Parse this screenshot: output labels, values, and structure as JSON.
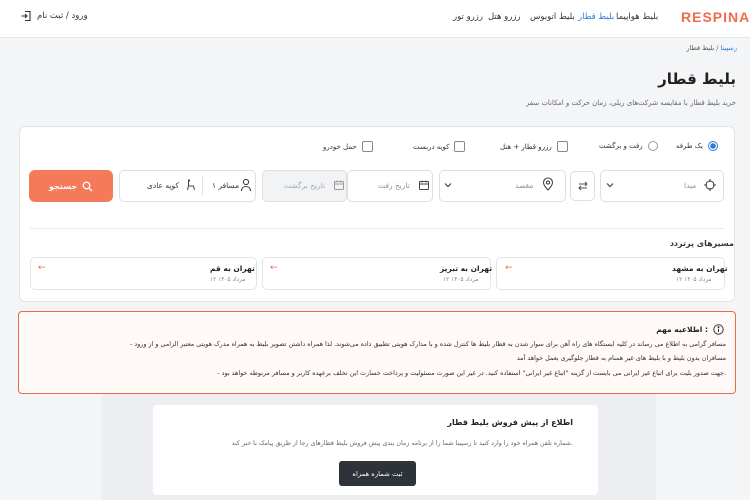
{
  "header": {
    "logo": "RESPINA",
    "nav": {
      "flight": "بلیط هواپیما",
      "train": "بلیط قطار",
      "bus": "بلیط اتوبوس",
      "hotel": "رزرو هتل",
      "tour": "رزرو تور"
    },
    "login_label": "ورود / ثبت نام"
  },
  "breadcrumb": {
    "home": "رسپینا",
    "separator": " / ",
    "current": "بلیط قطار"
  },
  "page": {
    "title": "بلیط قطار",
    "subtitle": "خرید بلیط قطار با مقایسه شرکت‌های ریلی، زمان حرکت و امکانات سفر"
  },
  "search": {
    "trip_types": {
      "one_way": "یک طرفه",
      "round_trip": "رفت و برگشت"
    },
    "extras": {
      "train_hotel": "رزرو قطار + هتل",
      "coupe": "کوپه دربست",
      "car": "حمل خودرو"
    },
    "selected_trip_type": "یک طرفه",
    "origin_placeholder": "مبدا",
    "destination_placeholder": "مقصد",
    "depart_placeholder": "تاریخ رفت",
    "return_placeholder": "تاریخ برگشت",
    "passengers": "۱ مسافر",
    "wagon_type": "کوپه عادی",
    "search_button": "جستجو"
  },
  "popular": {
    "title": "مسیرهای پرتردد",
    "routes": [
      {
        "name": "تهران به مشهد",
        "date": "۱۲ مرداد ۱۴۰۵"
      },
      {
        "name": "تهران به تبریز",
        "date": "۱۲ مرداد ۱۴۰۵"
      },
      {
        "name": "تهران به قم",
        "date": "۱۲ مرداد ۱۴۰۵"
      }
    ]
  },
  "notice": {
    "title": "اطلاعیه مهم :",
    "lines": [
      "- مسافر گرامی به اطلاع می رساند در کلیه ایستگاه های راه آهن برای سوار شدن به قطار بلیط ها کنترل شده و با مدارک هویتی تطبیق داده می‌شوند. لذا همراه داشتن تصویر بلیط به همراه مدرک هویتی معتبر الزامی و از ورود",
      "مسافران بدون بلیط و با بلیط های غیر همنام به قطار جلوگیری بعمل خواهد آمد",
      "- جهت صدور بلیت برای اتباع غیر ایرانی می بایست از گزینه \"اتباع غیر ایرانی\" استفاده کنید. در غیر این صورت مسئولیت و پرداخت خسارت این تخلف برعهده کاربر و مسافر مربوطه خواهد بود."
    ]
  },
  "presale": {
    "title": "اطلاع از پیش فروش بلیط قطار",
    "text": "شماره تلفن همراه خود را وارد کنید تا رسپینا شما را از برنامه زمان بندی پیش فروش بلیط قطارهای رجا از طریق پیامک با خبر کند.",
    "button": "ثبت شماره همراه"
  },
  "colors": {
    "brand": "#f26b4a",
    "accent": "#2e7bd6",
    "button_dark": "#2e3239"
  },
  "icons": [
    "log-in-icon",
    "radio-icon",
    "checkbox-icon",
    "crosshair-icon",
    "location-pin-icon",
    "swap-icon",
    "calendar-icon",
    "user-icon",
    "seat-icon",
    "search-icon",
    "arrow-left-icon",
    "info-icon"
  ]
}
